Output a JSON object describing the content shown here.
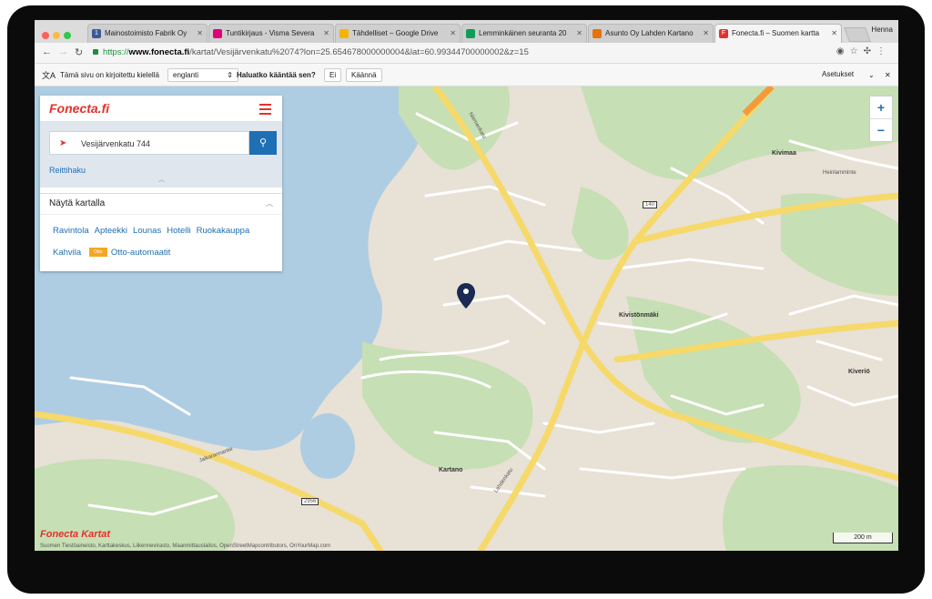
{
  "browser": {
    "tabs": [
      {
        "label": "Mainostoimisto Fabrik Oy",
        "icon": "fabrik-favicon",
        "color": "#3b5998"
      },
      {
        "label": "Tuntikirjaus - Visma Severa",
        "icon": "visma-favicon",
        "color": "#e2007a"
      },
      {
        "label": "Tähdelliset – Google Drive",
        "icon": "drive-favicon",
        "color": "#f4b400"
      },
      {
        "label": "Lemminkäinen seuranta 20",
        "icon": "sheets-favicon",
        "color": "#0f9d58"
      },
      {
        "label": "Asunto Oy Lahden Kartano",
        "icon": "asunto-favicon",
        "color": "#e8710a"
      },
      {
        "label": "Fonecta.fi – Suomen kartta",
        "icon": "fonecta-favicon",
        "color": "#e4312b"
      }
    ],
    "profile": "Henna",
    "url": {
      "secure_prefix": "https://",
      "host": "www.fonecta.fi",
      "path": "/kartat/Vesijärvenkatu%2074?lon=25.654678000000004&lat=60.99344700000002&z=15"
    }
  },
  "translate_bar": {
    "message": "Tämä sivu on kirjoitettu kielellä",
    "language": "englanti",
    "question": "Haluatko kääntää sen?",
    "no_label": "Ei",
    "translate_label": "Käännä",
    "settings_label": "Asetukset"
  },
  "panel": {
    "brand": "Fonecta.fi",
    "search_value": "Vesijärvenkatu 744",
    "route_label": "Reittihaku",
    "show_on_map": "Näytä kartalla",
    "categories": [
      "Ravintola",
      "Apteekki",
      "Lounas",
      "Hotelli",
      "Ruokakauppa",
      "Kahvila"
    ],
    "otto_badge": "Otto",
    "otto_label": "Otto-automaatit"
  },
  "map": {
    "zoom_in": "+",
    "zoom_out": "−",
    "scale_label": "200 m",
    "logo": "Fonecta Kartat",
    "attribution": "Suomen Tiestöaineisto, Karttakeskus, Liikennevirasto, Maanmittauslaitos, OpenStreetMapcontributors, OnYourMap.com",
    "labels": {
      "kivimaa": "Kivimaa",
      "kivistonmaki": "Kivistönmäki",
      "kiverio": "Kiveriö",
      "kartano": "Kartano",
      "niemenkatu": "Niemenkatu",
      "lahdenkatu": "Lahdenkatu",
      "heinlamminte": "Heinlamminte",
      "jalkarantantie": "Jalkarannantie",
      "road_140": "140",
      "road_2956": "2956"
    }
  }
}
